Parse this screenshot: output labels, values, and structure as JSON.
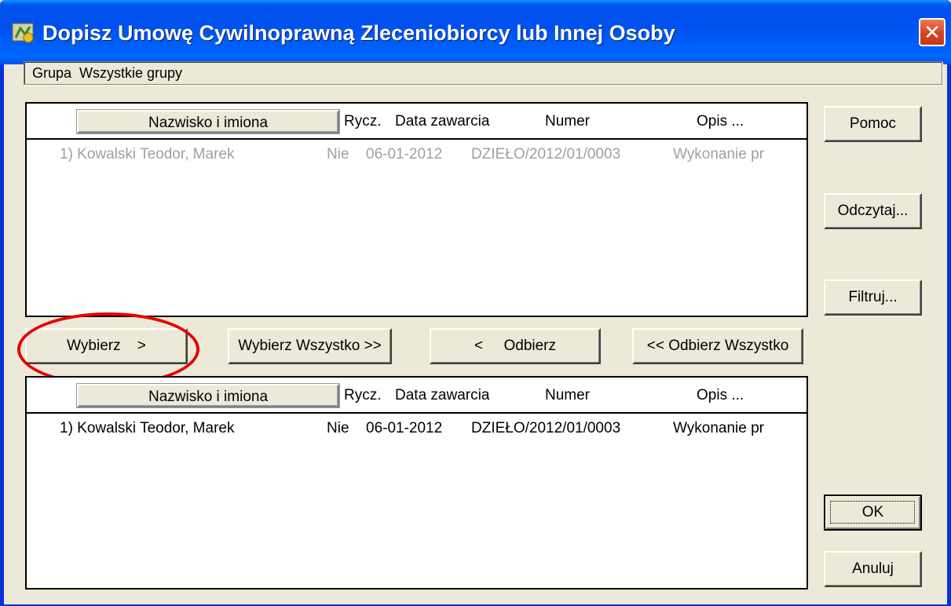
{
  "window": {
    "title": "Dopisz Umowę Cywilnoprawną Zleceniobiorcy lub Innej Osoby",
    "close_label": "✕"
  },
  "group": {
    "label": "Grupa",
    "value": "Wszystkie grupy"
  },
  "columns": {
    "name": "Nazwisko i imiona",
    "rycz": "Rycz.",
    "data": "Data zawarcia",
    "numer": "Numer",
    "opis": "Opis ..."
  },
  "available_list": {
    "rows": [
      {
        "name": "1) Kowalski Teodor, Marek",
        "rycz": "Nie",
        "data": "06-01-2012",
        "numer": "DZIEŁO/2012/01/0003",
        "opis": "Wykonanie pr"
      }
    ]
  },
  "selected_list": {
    "rows": [
      {
        "name": "1) Kowalski Teodor, Marek",
        "rycz": "Nie",
        "data": "06-01-2012",
        "numer": "DZIEŁO/2012/01/0003",
        "opis": "Wykonanie pr"
      }
    ]
  },
  "buttons": {
    "pomoc": "Pomoc",
    "odczytaj": "Odczytaj...",
    "filtruj": "Filtruj...",
    "ok": "OK",
    "anuluj": "Anuluj",
    "wybierz": "Wybierz    >",
    "wybierz_wszystko": "Wybierz Wszystko >>",
    "odbierz": "<     Odbierz",
    "odbierz_wszystko": "<< Odbierz Wszystko"
  },
  "colors": {
    "titlebar": "#0054e3",
    "window_bg": "#ece9d8",
    "annotation": "#e60000",
    "disabled_text": "#a0a0a0"
  }
}
